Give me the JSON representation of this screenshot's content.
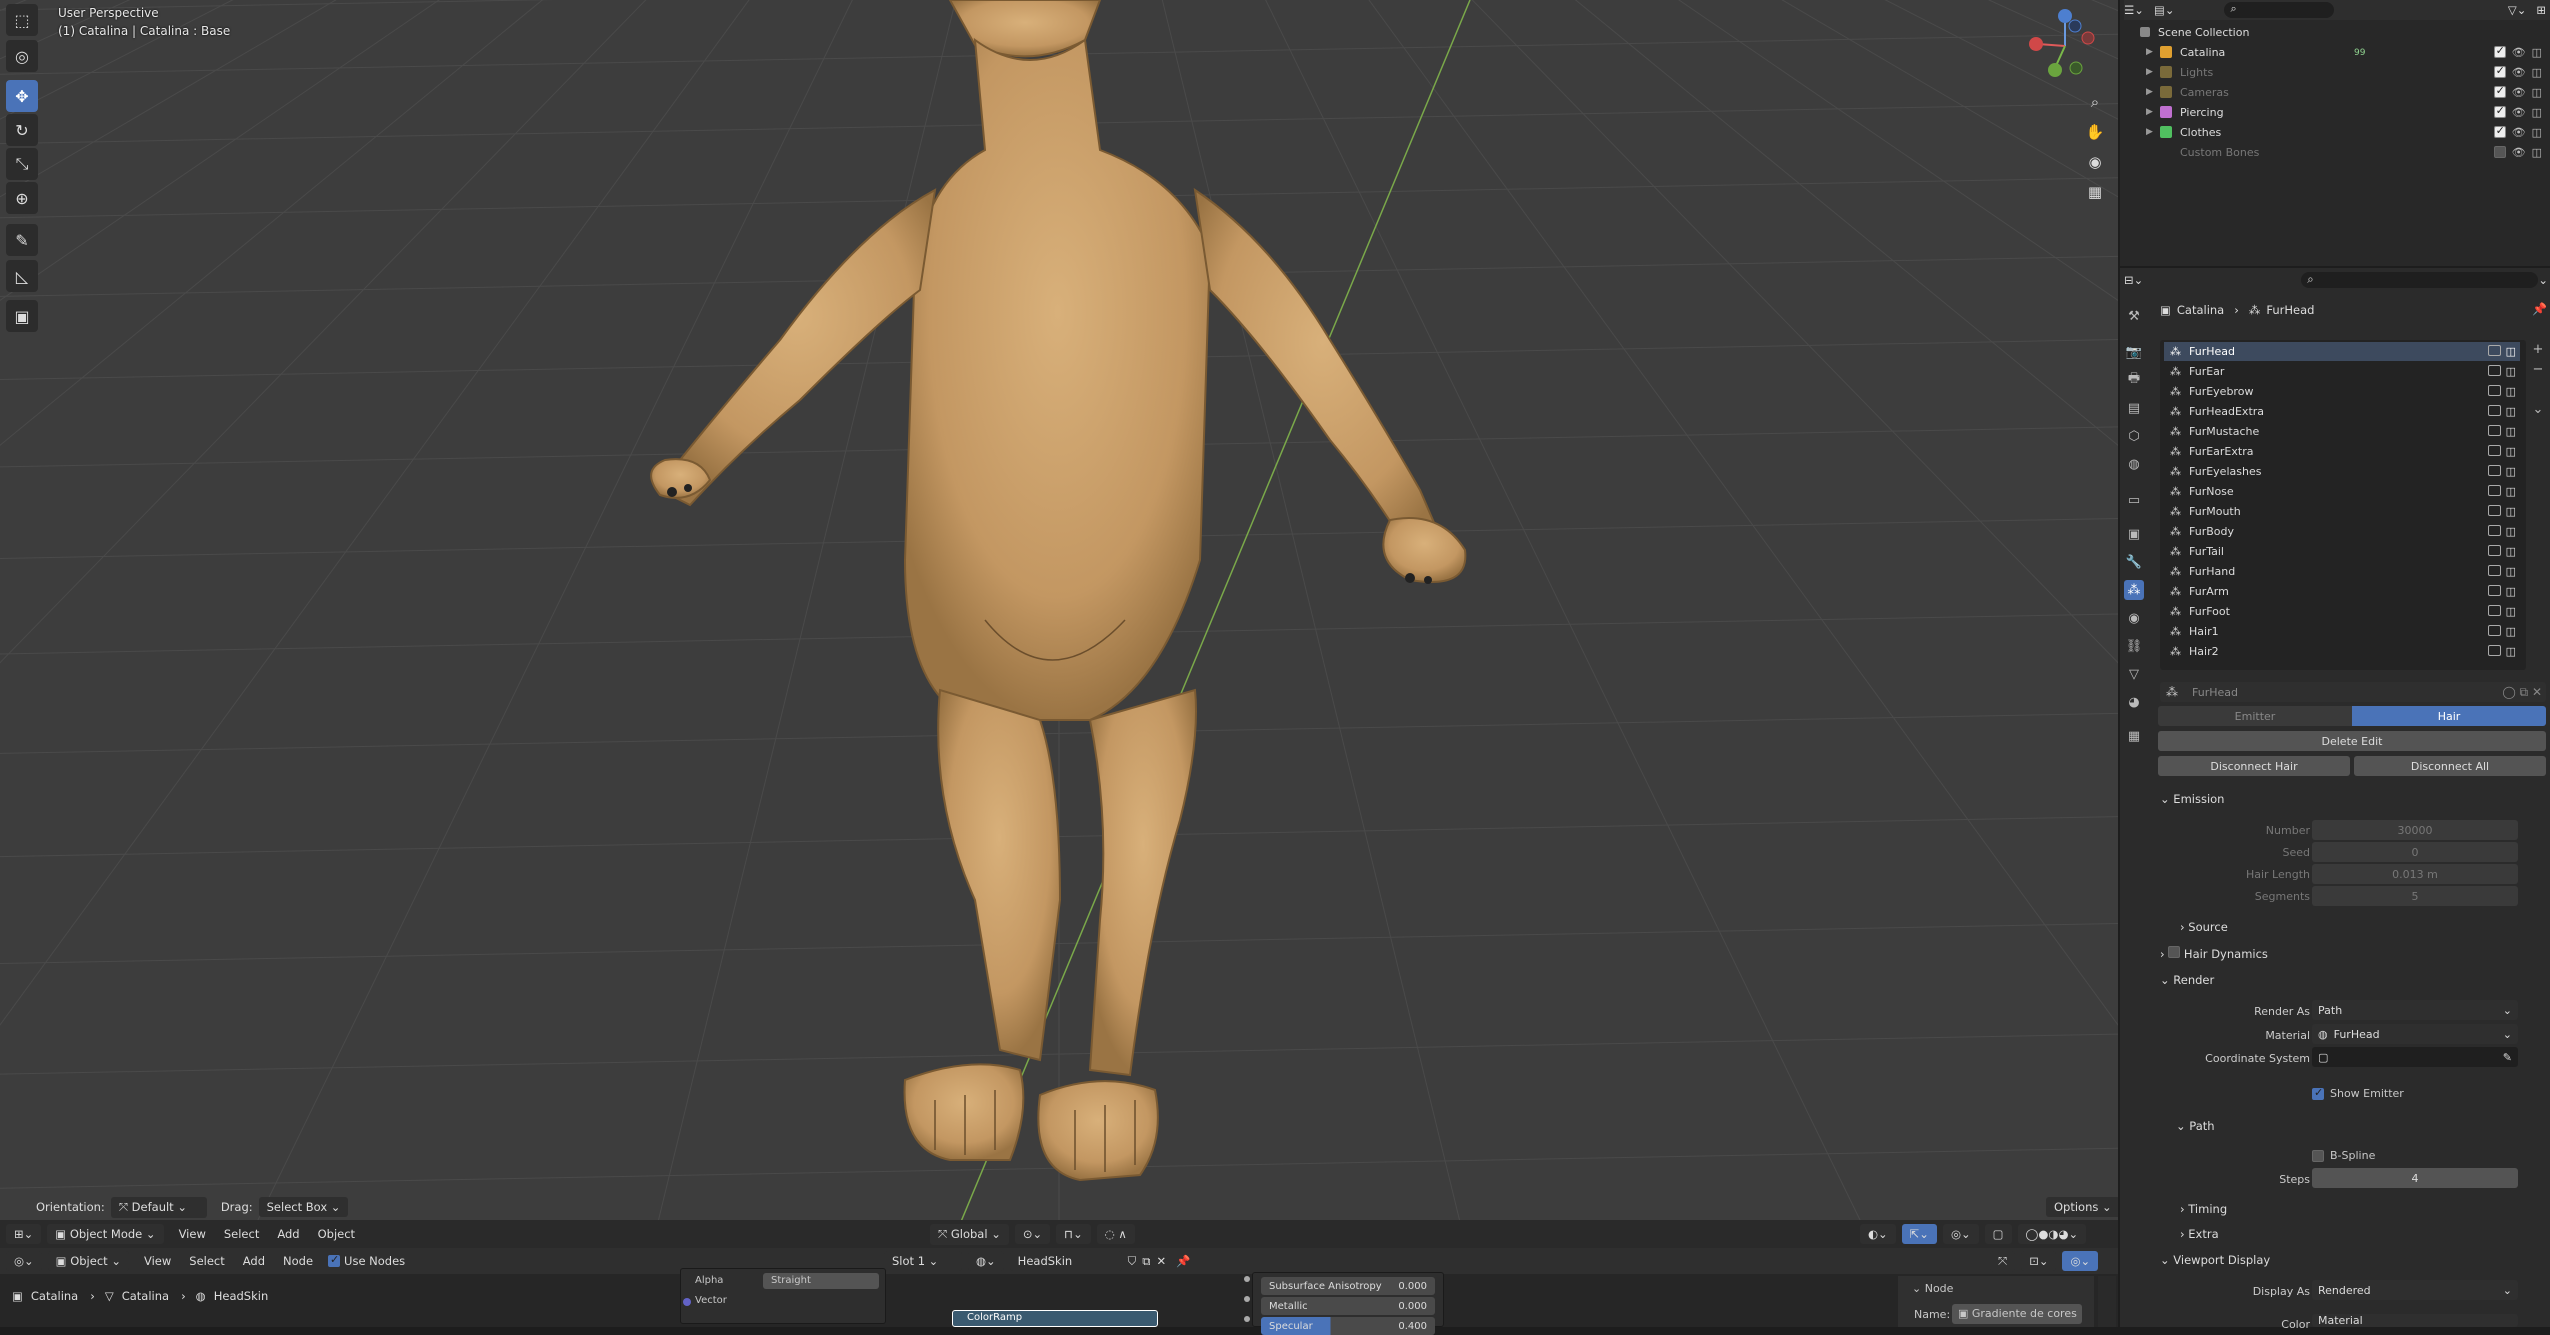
{
  "viewport": {
    "overlay_title": "User Perspective",
    "overlay_subtitle": "(1) Catalina | Catalina : Base",
    "tools": [
      "select-box",
      "cursor",
      "move",
      "rotate",
      "scale",
      "transform",
      "annotate",
      "measure",
      "add-cube"
    ],
    "header": {
      "orientation_label": "Orientation:",
      "orientation_value": "Default",
      "drag_label": "Drag:",
      "drag_value": "Select Box",
      "options": "Options"
    },
    "bottom_bar": {
      "mode": "Object Mode",
      "menus": [
        "View",
        "Select",
        "Add",
        "Object"
      ],
      "transform_orientation": "Global"
    }
  },
  "node_editor": {
    "header": {
      "object_type": "Object",
      "menus": [
        "View",
        "Select",
        "Add",
        "Node"
      ],
      "use_nodes_label": "Use Nodes",
      "slot": "Slot 1",
      "material": "HeadSkin"
    },
    "breadcrumb": [
      "Catalina",
      "Catalina",
      "HeadSkin"
    ],
    "node_sockets": {
      "alpha": "Alpha",
      "straight": "Straight",
      "vector": "Vector",
      "colorramp": "ColorRamp"
    },
    "principled_rows": [
      {
        "label": "Subsurface Anisotropy",
        "value": "0.000"
      },
      {
        "label": "Metallic",
        "value": "0.000"
      },
      {
        "label": "Specular",
        "value": "0.400"
      }
    ],
    "side_panel": {
      "section": "Node",
      "name_label": "Name:",
      "name_value": "Gradiente de cores"
    }
  },
  "outliner": {
    "root": "Scene Collection",
    "items": [
      {
        "label": "Catalina",
        "color": "#e0a030",
        "dim": false,
        "checked": true
      },
      {
        "label": "Lights",
        "color": "#7a6a3a",
        "dim": true,
        "checked": true
      },
      {
        "label": "Cameras",
        "color": "#7a6a3a",
        "dim": true,
        "checked": true
      },
      {
        "label": "Piercing",
        "color": "#c070d0",
        "dim": false,
        "checked": true
      },
      {
        "label": "Clothes",
        "color": "#50c060",
        "dim": false,
        "checked": true
      },
      {
        "label": "Custom Bones",
        "color": "",
        "dim": true,
        "checked": false
      }
    ],
    "badge_count": "99"
  },
  "properties": {
    "breadcrumb": [
      "Catalina",
      "FurHead"
    ],
    "particle_systems": [
      "FurHead",
      "FurEar",
      "FurEyebrow",
      "FurHeadExtra",
      "FurMustache",
      "FurEarExtra",
      "FurEyelashes",
      "FurNose",
      "FurMouth",
      "FurBody",
      "FurTail",
      "FurHand",
      "FurArm",
      "FurFoot",
      "Hair1",
      "Hair2"
    ],
    "selected": "FurHead",
    "settings_name": "FurHead",
    "type_tabs": {
      "emitter": "Emitter",
      "hair": "Hair"
    },
    "delete_edit": "Delete Edit",
    "disconnect_hair": "Disconnect Hair",
    "disconnect_all": "Disconnect All",
    "emission": {
      "title": "Emission",
      "number_label": "Number",
      "number": "30000",
      "seed_label": "Seed",
      "seed": "0",
      "hair_length_label": "Hair Length",
      "hair_length": "0.013 m",
      "segments_label": "Segments",
      "segments": "5"
    },
    "source": "Source",
    "hair_dynamics": "Hair Dynamics",
    "render": {
      "title": "Render",
      "render_as_label": "Render As",
      "render_as": "Path",
      "material_label": "Material",
      "material": "FurHead",
      "coord_label": "Coordinate System",
      "show_emitter": "Show Emitter"
    },
    "path": {
      "title": "Path",
      "bspline": "B-Spline",
      "steps_label": "Steps",
      "steps": "4"
    },
    "timing": "Timing",
    "extra": "Extra",
    "viewport_display": {
      "title": "Viewport Display",
      "display_as_label": "Display As",
      "display_as": "Rendered",
      "color_label": "Color",
      "color_value": "Material"
    }
  },
  "colors": {
    "accent": "#4a73b8",
    "fur": "#c9a06a",
    "viewport_bg": "#3d3d3d"
  }
}
